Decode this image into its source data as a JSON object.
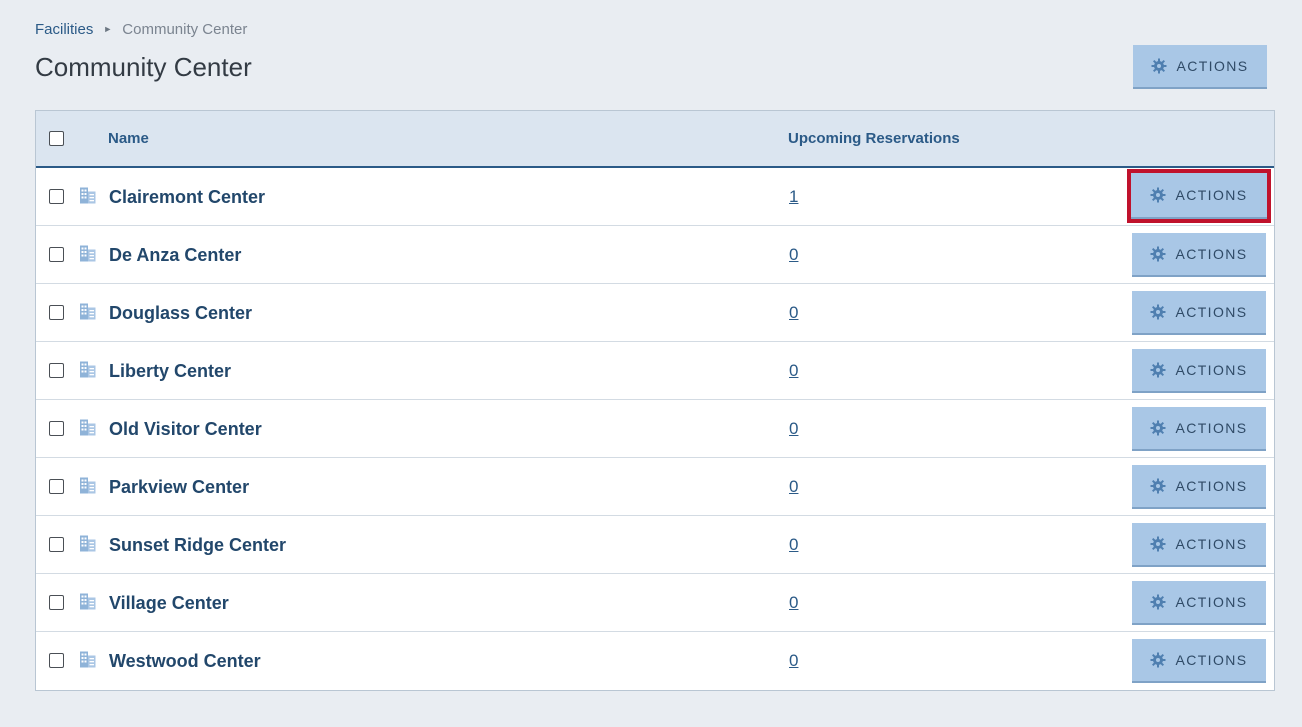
{
  "breadcrumb": {
    "parent": "Facilities",
    "current": "Community Center"
  },
  "page": {
    "title": "Community Center",
    "actions_label": "ACTIONS"
  },
  "table": {
    "columns": {
      "name": "Name",
      "upcoming": "Upcoming Reservations"
    },
    "rows": [
      {
        "name": "Clairemont Center",
        "upcoming": "1",
        "actions_label": "ACTIONS"
      },
      {
        "name": "De Anza Center",
        "upcoming": "0",
        "actions_label": "ACTIONS"
      },
      {
        "name": "Douglass Center",
        "upcoming": "0",
        "actions_label": "ACTIONS"
      },
      {
        "name": "Liberty Center",
        "upcoming": "0",
        "actions_label": "ACTIONS"
      },
      {
        "name": "Old Visitor Center",
        "upcoming": "0",
        "actions_label": "ACTIONS"
      },
      {
        "name": "Parkview Center",
        "upcoming": "0",
        "actions_label": "ACTIONS"
      },
      {
        "name": "Sunset Ridge Center",
        "upcoming": "0",
        "actions_label": "ACTIONS"
      },
      {
        "name": "Village Center",
        "upcoming": "0",
        "actions_label": "ACTIONS"
      },
      {
        "name": "Westwood Center",
        "upcoming": "0",
        "actions_label": "ACTIONS"
      }
    ]
  },
  "icons": {
    "gear": "gear-icon",
    "building": "building-icon",
    "breadcrumb_separator": "triangle-right-icon"
  },
  "colors": {
    "button_bg": "#a9c7e6",
    "link": "#2b5a87",
    "highlight": "#c0122c"
  }
}
